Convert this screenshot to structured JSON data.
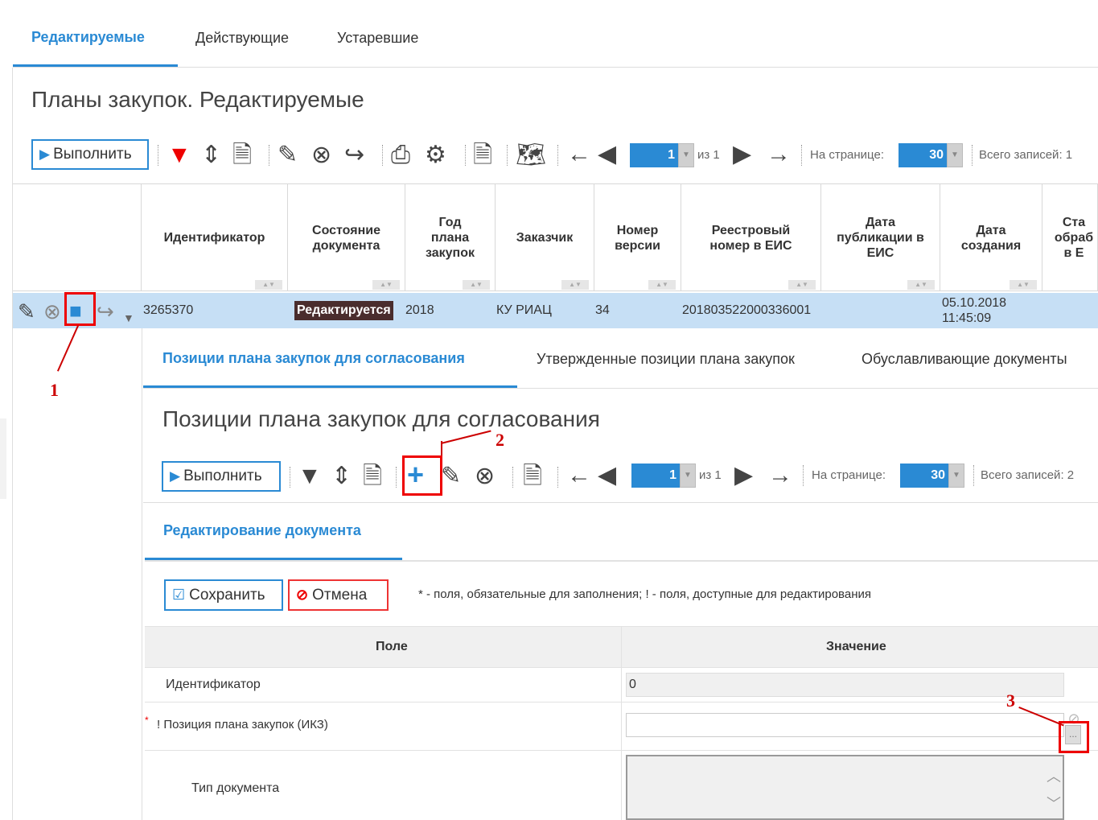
{
  "tabs": {
    "active": "Редактируемые",
    "items": [
      "Действующие",
      "Устаревшие"
    ]
  },
  "page_title": "Планы закупок. Редактируемые",
  "toolbar": {
    "run_label": "Выполнить",
    "page_value": "1",
    "page_of": "из 1",
    "per_page_label": "На странице:",
    "per_page_value": "30",
    "total_label": "Всего записей: 1"
  },
  "table": {
    "columns": [
      "Идентификатор",
      "Состояние документа",
      "Год плана закупок",
      "Заказчик",
      "Номер версии",
      "Реестровый номер в ЕИС",
      "Дата публикации в ЕИС",
      "Дата создания",
      "Ста обраб в Е"
    ],
    "row": {
      "id": "3265370",
      "status": "Редактируется",
      "year": "2018",
      "customer": "КУ РИАЦ",
      "version": "34",
      "reg_number": "201803522000336001",
      "pub_date": "",
      "created": "05.10.2018 11:45:09"
    }
  },
  "subtabs": {
    "active": "Позиции плана закупок для согласования",
    "items": [
      "Утвержденные позиции плана закупок",
      "Обуславливающие документы"
    ]
  },
  "section_title": "Позиции плана закупок для согласования",
  "toolbar2": {
    "run_label": "Выполнить",
    "page_value": "1",
    "page_of": "из 1",
    "per_page_label": "На странице:",
    "per_page_value": "30",
    "total_label": "Всего записей: 2"
  },
  "edit_tab": "Редактирование документа",
  "form": {
    "save_label": "Сохранить",
    "cancel_label": "Отмена",
    "hint": "* - поля, обязательные для заполнения; ! - поля, доступные для редактирования",
    "col_field": "Поле",
    "col_value": "Значение",
    "rows": [
      {
        "label": "Идентификатор",
        "value": "0"
      },
      {
        "label": "! Позиция плана закупок (ИКЗ)",
        "value": ""
      },
      {
        "label": "Тип документа",
        "value": ""
      }
    ]
  },
  "annotations": [
    "1",
    "2",
    "3"
  ],
  "colors": {
    "accent": "#2a8ad4",
    "selected_row": "#c6dff5",
    "marker": "#e00000",
    "status_badge": "#4a2d2d"
  }
}
